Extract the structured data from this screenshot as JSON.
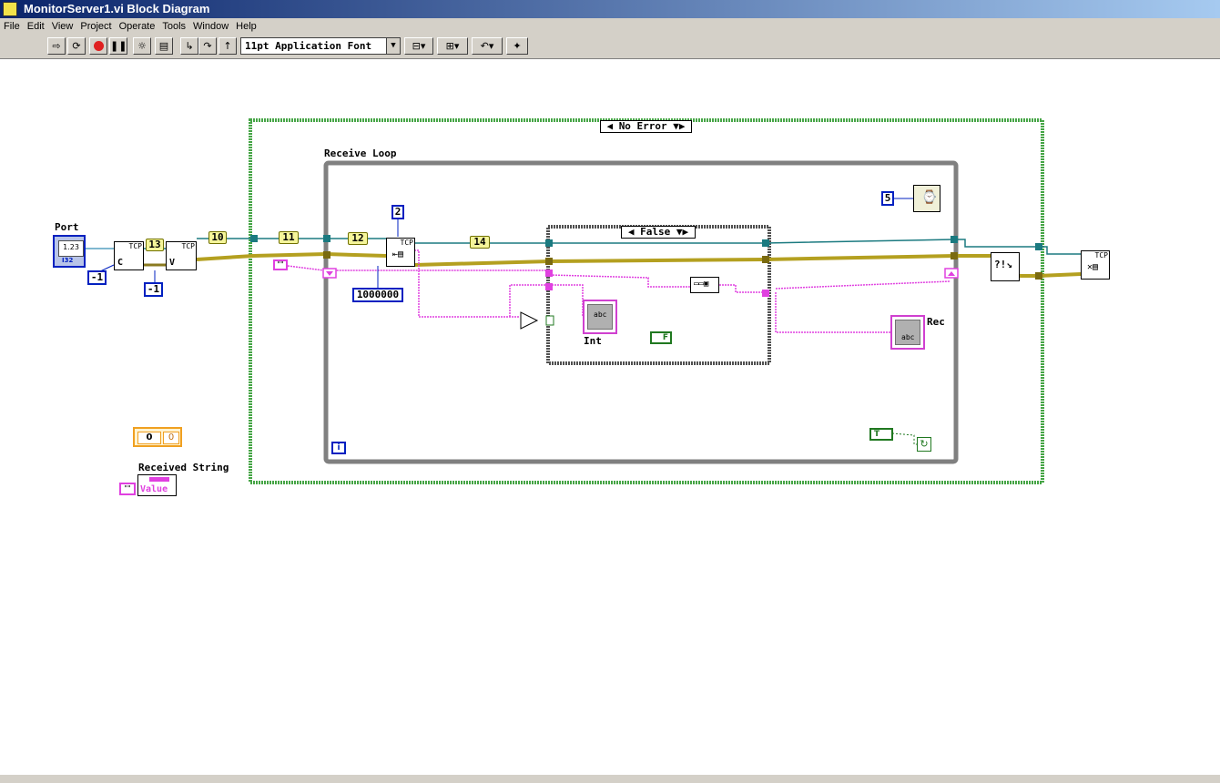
{
  "window": {
    "title": "MonitorServer1.vi Block Diagram"
  },
  "menu": [
    "File",
    "Edit",
    "View",
    "Project",
    "Operate",
    "Tools",
    "Window",
    "Help"
  ],
  "toolbar": {
    "font": "11pt Application Font"
  },
  "structures": {
    "case_outer": "No Error",
    "loop_label": "Receive Loop",
    "case_inner": "False",
    "loop_iter": "i"
  },
  "labels": {
    "port": "Port",
    "int_ind": "Int",
    "rec_ind": "Rec",
    "received_string": "Received String",
    "value": "Value"
  },
  "constants": {
    "c_minus1_a": "-1",
    "c_minus1_b": "-1",
    "c_2": "2",
    "c_1000000": "1000000",
    "c_5": "5",
    "c_0_a": "0",
    "c_0_b": "0"
  },
  "wire_numbers": [
    "13",
    "10",
    "11",
    "12",
    "14"
  ],
  "node_text": {
    "tcp": "TCP",
    "port_ctrl": "1.23",
    "port_type": "I32",
    "abc": "abc",
    "str_const": "\"\"",
    "true_const": "T",
    "false_const": "F"
  }
}
